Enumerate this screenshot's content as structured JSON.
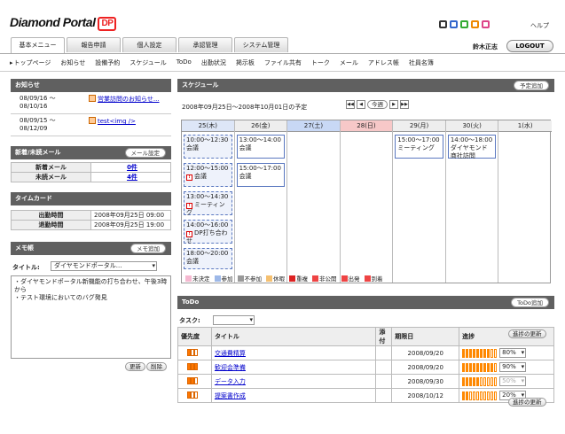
{
  "header": {
    "logo_text": "Diamond Portal",
    "logo_mark": "DP",
    "color_swatches": [
      "#333333",
      "#3366cc",
      "#33aa33",
      "#ee8800",
      "#dd4488"
    ],
    "help": "ヘルプ",
    "user_name": "鈴木正志",
    "logout": "LOGOUT",
    "tabs": [
      "基本メニュー",
      "報告申請",
      "個人設定",
      "承認管理",
      "システム管理"
    ],
    "nav": [
      "トップページ",
      "お知らせ",
      "設備予約",
      "スケジュール",
      "ToDo",
      "出勤状況",
      "掲示板",
      "ファイル共有",
      "トーク",
      "メール",
      "アドレス帳",
      "社員名簿"
    ]
  },
  "news": {
    "title": "お知らせ",
    "items": [
      {
        "date1": "08/09/16 ～",
        "date2": "08/10/16",
        "text": "営業訪問のお知らせ..."
      },
      {
        "date1": "08/09/15 ～",
        "date2": "08/12/09",
        "text": "test<img />"
      }
    ]
  },
  "mail": {
    "title": "新着/未読メール",
    "button": "メール設定",
    "rows": [
      {
        "label": "新着メール",
        "value": "0件"
      },
      {
        "label": "未読メール",
        "value": "4件"
      }
    ]
  },
  "timecard": {
    "title": "タイムカード",
    "rows": [
      {
        "label": "出勤時間",
        "value": "2008年09月25日 09:00"
      },
      {
        "label": "退勤時間",
        "value": "2008年09月25日 19:00"
      }
    ]
  },
  "memo": {
    "title": "メモ帳",
    "add_button": "メモ追加",
    "title_label": "タイトル:",
    "title_value": "ダイヤモンドポータル...",
    "body": "・ダイヤモンドポータル新機能の打ち合わせ、午後3時から\n・テスト環境においてのバグ発見",
    "update": "更新",
    "delete": "削除"
  },
  "schedule": {
    "title": "スケジュール",
    "add_button": "予定追加",
    "range": "2008年09月25日～2008年10月01日の予定",
    "today": "今週",
    "days": [
      {
        "label": "25(木)",
        "color": "#dde6f7"
      },
      {
        "label": "26(金)",
        "color": "#eeeeee"
      },
      {
        "label": "27(土)",
        "color": "#c8d8f5"
      },
      {
        "label": "28(日)",
        "color": "#f7c8c8"
      },
      {
        "label": "29(月)",
        "color": "#eeeeee"
      },
      {
        "label": "30(火)",
        "color": "#eeeeee"
      },
      {
        "label": "1(水)",
        "color": "#eeeeee"
      }
    ],
    "events": [
      {
        "day": 0,
        "slot": 0,
        "time": "10:00～12:30",
        "text": "会議",
        "important": false,
        "selected": true
      },
      {
        "day": 0,
        "slot": 1,
        "time": "12:00～15:00",
        "text": "会議",
        "important": true,
        "selected": true
      },
      {
        "day": 0,
        "slot": 2,
        "time": "13:00～14:30",
        "text": "ミーティング",
        "important": true,
        "selected": true
      },
      {
        "day": 0,
        "slot": 3,
        "time": "14:00～16:00",
        "text": "DP打ち合わせ",
        "important": true,
        "selected": true
      },
      {
        "day": 0,
        "slot": 4,
        "time": "18:00～20:00",
        "text": "会議",
        "important": false,
        "selected": true
      },
      {
        "day": 1,
        "slot": 0,
        "time": "13:00～14:00",
        "text": "会議",
        "important": false,
        "selected": false
      },
      {
        "day": 1,
        "slot": 1,
        "time": "15:00～17:00",
        "text": "会議",
        "important": false,
        "selected": false
      },
      {
        "day": 4,
        "slot": 0,
        "time": "15:00～17:00",
        "text": "ミーティング",
        "important": false,
        "selected": false
      },
      {
        "day": 5,
        "slot": 0,
        "time": "14:00～18:00",
        "text": "ダイヤモンド商社訪問",
        "important": false,
        "selected": false
      }
    ],
    "legend": [
      {
        "label": "未決定",
        "color": "#f5b8d0"
      },
      {
        "label": "参加",
        "color": "#9db8e8"
      },
      {
        "label": "不参加",
        "color": "#999999"
      },
      {
        "label": "休暇",
        "color": "#f5c070"
      },
      {
        "label": "重複",
        "color": "#dd2222"
      },
      {
        "label": "非公開",
        "color": "#ee4444"
      },
      {
        "label": "出発",
        "color": "#ee4444"
      },
      {
        "label": "到着",
        "color": "#ee4444"
      }
    ]
  },
  "todo": {
    "title": "ToDo",
    "add_button": "ToDo追加",
    "task_label": "タスク:",
    "headers": [
      "優先度",
      "タイトル",
      "添付",
      "期限日",
      "進捗"
    ],
    "update_button": "進捗の更新",
    "items": [
      {
        "priority": 1,
        "title": "交通費精算",
        "due": "2008/09/20",
        "progress": "80%",
        "filled": 8
      },
      {
        "priority": 3,
        "title": "歓迎会準備",
        "due": "2008/09/20",
        "progress": "90%",
        "filled": 9
      },
      {
        "priority": 2,
        "title": "データ入力",
        "due": "2008/09/30",
        "progress": "50%",
        "filled": 5
      },
      {
        "priority": 1,
        "title": "提案書作成",
        "due": "2008/10/12",
        "progress": "20%",
        "filled": 2
      }
    ]
  }
}
